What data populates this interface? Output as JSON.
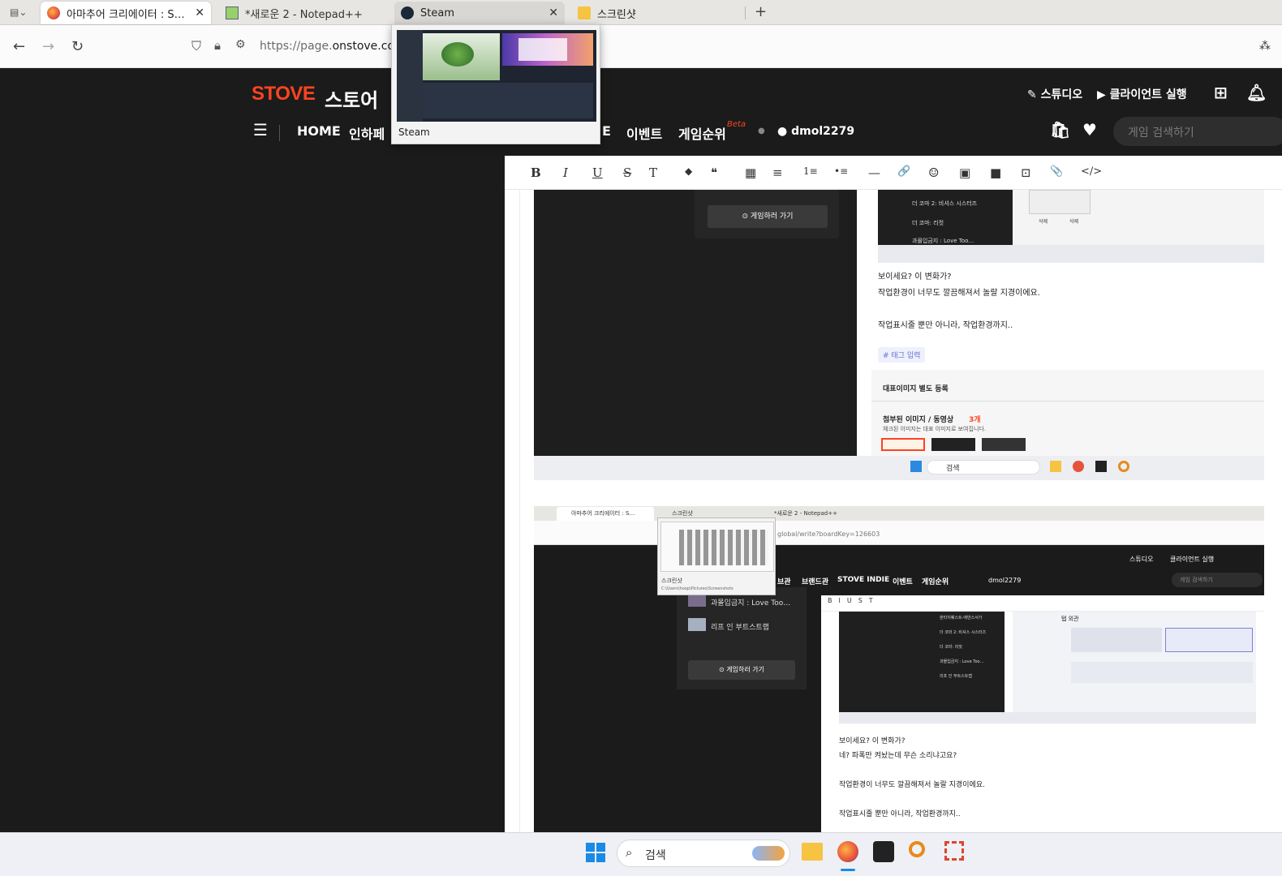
{
  "browser": {
    "tabs": [
      {
        "label": "아마추어 크리에이터 : S…",
        "icon": "firefox-icon",
        "active": true
      },
      {
        "label": "*새로운 2 - Notepad++",
        "icon": "notepad-icon"
      },
      {
        "label": "Steam",
        "icon": "steam-icon"
      },
      {
        "label": "스크린샷",
        "icon": "folder-icon"
      }
    ],
    "new_tab": "+",
    "url_prefix": "https://page.",
    "url_domain": "onstove.com/",
    "preview_label": "Steam"
  },
  "site": {
    "logo": "STOVE",
    "logo_sub": "스토어",
    "studio": "스튜디오",
    "client": "클라이언트 실행",
    "nav": [
      "HOME",
      "인하페",
      "E",
      "이벤트",
      "게임순위"
    ],
    "beta": "Beta",
    "user": "dmol2279",
    "search_placeholder": "게임 검색하기"
  },
  "editor": {
    "toolbar": [
      "B",
      "I",
      "U",
      "S",
      "T",
      "◆",
      "❝",
      "▦",
      "≡",
      "1≡",
      "•≡",
      "—",
      "🔗",
      "☺",
      "▣",
      "■",
      "⊡",
      "📎",
      "</>"
    ]
  },
  "content": {
    "shot1": {
      "go_game": "게임하러 가기",
      "list": [
        "더 코마 2: 비셔스 시스터즈",
        "더 코마: 리컷",
        "과몰입금지 : Love Too…"
      ],
      "delete1": "삭제",
      "delete2": "삭제",
      "line1": "보이세요? 이 변화가?",
      "line2": "작업환경이 너무도 깔끔해져서 놀랄 지경이에요.",
      "line3": "작업표시줄 뿐만 아니라, 작업환경까지..",
      "tag": "# 태그 입력",
      "rep_image": "대표이미지 별도 등록",
      "attached": "첨부된 이미지 / 동영상",
      "attached_count": "3개",
      "attached_desc": "체크된 이미지는 대표 이미지로 보여집니다.",
      "taskbar_search": "검색"
    },
    "shot2": {
      "tabs": [
        "아마추어 크리에이터 : S…",
        "스크린샷",
        "*새로운 2 - Notepad++"
      ],
      "url": "global/write?boardKey=126603",
      "preview_label": "스크린샷",
      "preview_path": "C:\\Users\\hoop\\Pictures\\Screenshots",
      "studio": "스튜디오",
      "client": "클라이언트 실행",
      "nav": [
        "브관",
        "브랜드관",
        "STOVE INDIE",
        "이벤트",
        "게임순위"
      ],
      "user": "dmol2279",
      "search": "게임 검색하기",
      "list": [
        "과몰입금지 : Love Too…",
        "리프 인 부트스트랩"
      ],
      "go_game": "게임하러 가기",
      "inner_list": [
        "판타지퀘스트-에반스서가",
        "더 코마 2: 비셔스 시스터즈",
        "더 코마: 리컷",
        "과몰입금지 : Love Too…",
        "리프 인 부트스트랩"
      ],
      "inner_title": "탭 외관",
      "line1": "보이세요? 이 변화가?",
      "line2": "네? 파폭만 켜놨는데 무슨 소리냐고요?",
      "line3": "작업환경이 너무도 깔끔해져서 놀랄 지경이에요.",
      "line4": "작업표시줄 뿐만 아니라, 작업환경까지.."
    }
  },
  "taskbar": {
    "search": "검색"
  }
}
